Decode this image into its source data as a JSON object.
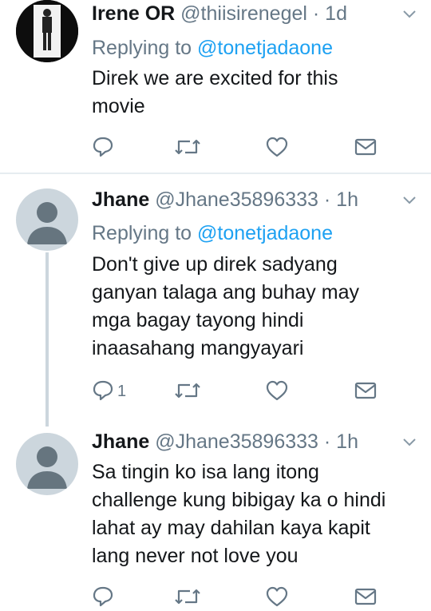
{
  "tweets": [
    {
      "name": "Irene OR",
      "handle": "@thiisirenegel",
      "time": "· 1d",
      "reply_prefix": "Replying to",
      "reply_to": "@tonetjadaone",
      "text_lines": [
        "Direk we are excited for this",
        "movie"
      ],
      "reply_count": "",
      "avatar": "photo"
    },
    {
      "name": "Jhane",
      "handle": "@Jhane35896333",
      "time": "· 1h",
      "reply_prefix": "Replying to",
      "reply_to": "@tonetjadaone",
      "text_lines": [
        "Don't give up direk sadyang",
        "ganyan talaga ang buhay may",
        "mga bagay tayong hindi",
        "inaasahang mangyayari"
      ],
      "reply_count": "1",
      "avatar": "default"
    },
    {
      "name": "Jhane",
      "handle": "@Jhane35896333",
      "time": "· 1h",
      "text_lines": [
        "Sa tingin ko isa lang itong",
        "challenge kung bibigay ka o hindi",
        "lahat ay may dahilan kaya kapit",
        "lang never not love you"
      ],
      "reply_count": "",
      "avatar": "default"
    }
  ],
  "icons": {
    "reply": "reply-icon",
    "retweet": "retweet-icon",
    "like": "heart-icon",
    "dm": "mail-icon",
    "more": "chevron-down-icon"
  },
  "colors": {
    "accent": "#1da1f2",
    "secondary": "#657786",
    "icon": "#657786"
  }
}
